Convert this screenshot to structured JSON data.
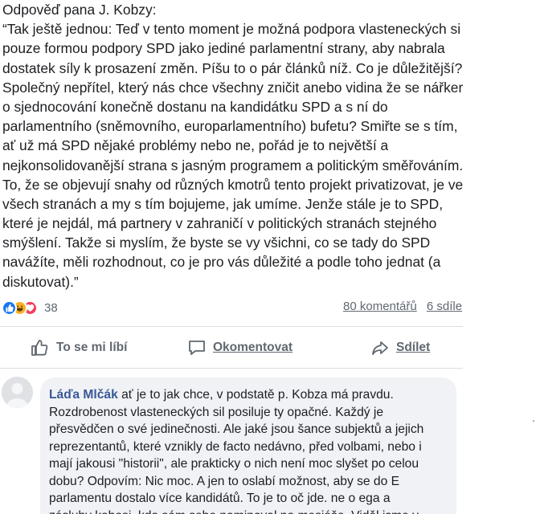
{
  "post": {
    "lines": [
      "Odpověď pana J. Kobzy:",
      "“Tak ještě jednou: Teď v tento moment je možná podpora vlasteneckých si",
      "pouze formou podpory SPD jako jediné parlamentní strany, aby nabrala",
      "dostatek síly k prosazení změn. Píšu to o pár článků níž. Co je důležitější?",
      "Společný nepřítel, který nás chce všechny zničit anebo vidina že se nářker",
      "o sjednocování konečně dostanu na kandidátku SPD a s ní do",
      "parlamentního (sněmovního, europarlamentního) bufetu? Smiřte se s tím,",
      "ať už má SPD nějaké problémy nebo ne, pořád je to největší a",
      "nejkonsolidovanější strana s jasným programem a politickým směřováním.",
      "To, že se objevují snahy od různých kmotrů tento projekt privatizovat, je ve",
      "všech stranách a my s tím bojujeme, jak umíme. Jenže stále je to SPD,",
      "které je nejdál, má partnery v zahraničí v politických stranách stejného",
      "smýšlení. Takže si myslím, že byste se vy všichni, co se tady do SPD",
      "navážíte, měli rozhodnout, co je pro vás důležité a podle toho jednat (a",
      "diskutovat).”"
    ]
  },
  "reactions": {
    "icons": [
      "like-reaction",
      "haha-reaction",
      "love-reaction"
    ],
    "count": "38",
    "comments": "80 komentářů",
    "shares": "6 sdíle"
  },
  "actions": {
    "like": "To se mi líbí",
    "comment": "Okomentovat",
    "share": "Sdílet"
  },
  "comment": {
    "author": "Láďa Mlčák",
    "first_line_rest": " ať je to jak chce, v podstatě p. Kobza má pravdu.",
    "lines": [
      "Rozdrobenost vlasteneckých sil posiluje ty opačné. Každý je",
      "přesvědčen o své jedinečnosti. Ale jaké jsou šance subjektů a jejich",
      "reprezentantů, které vznikly de facto nedávno, před volbami, nebo i",
      "mají jakousi \"historii\", ale prakticky o nich není moc slyšet po celou",
      "dobu? Odpovím: Nic moc. A jen to oslabí možnost, aby se do E",
      "parlamentu dostalo více kandidátů. To je to oč jde. ne o ega a",
      "zásluhy kohosi, kdo sám sebe nominoval na mesiáše. Viděl jsme v"
    ]
  },
  "misc": {
    "stray_mark": "'"
  },
  "colors": {
    "link": "#385898",
    "like_blue": "#1877f2",
    "haha_yellow": "#f7b125",
    "love_red": "#f33e58",
    "muted": "#606770",
    "bubble": "#f0f2f5"
  }
}
